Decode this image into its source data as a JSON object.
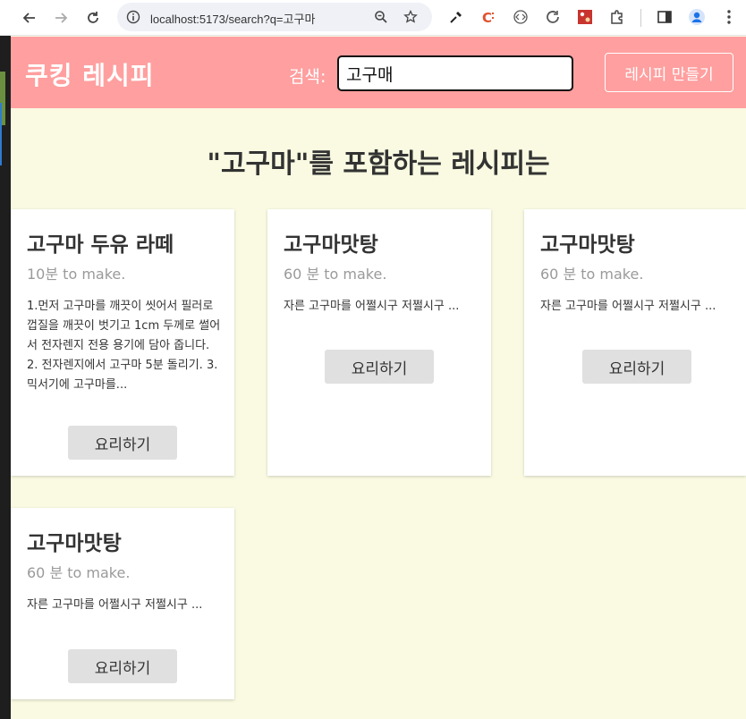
{
  "browser": {
    "url": "localhost:5173/search?q=고구마",
    "icons": [
      "back-arrow-icon",
      "forward-arrow-icon",
      "reload-icon",
      "site-info-icon",
      "zoom-icon",
      "bookmark-star-icon",
      "eyedropper-icon",
      "extension-c-icon",
      "extension-code-icon",
      "extension-refresh-icon",
      "extension-image-icon",
      "extensions-puzzle-icon",
      "side-panel-icon",
      "profile-icon",
      "menu-icon"
    ]
  },
  "header": {
    "logo": "쿠킹 레시피",
    "search_label": "검색:",
    "search_value": "고구매",
    "create_button": "레시피 만들기"
  },
  "results": {
    "heading": "\"고구마\"를 포함하는 레시피는"
  },
  "cards": [
    {
      "title": "고구마 두유 라떼",
      "time": "10분 to make.",
      "description": "1.먼저 고구마를 깨끗이 씻어서 필러로 껍질을 깨끗이 벗기고 1cm 두께로 썰어서 전자렌지 전용 용기에 담아 줍니다. 2. 전자렌지에서 고구마 5분 돌리기. 3. 믹서기에 고구마를...",
      "button": "요리하기"
    },
    {
      "title": "고구마맛탕",
      "time": "60 분 to make.",
      "description": "자른 고구마를 어쩔시구 저쩔시구 ...",
      "button": "요리하기"
    },
    {
      "title": "고구마맛탕",
      "time": "60 분 to make.",
      "description": "자른 고구마를 어쩔시구 저쩔시구 ...",
      "button": "요리하기"
    },
    {
      "title": "고구마맛탕",
      "time": "60 분 to make.",
      "description": "자른 고구마를 어쩔시구 저쩔시구 ...",
      "button": "요리하기"
    }
  ],
  "colors": {
    "header": "#ff9f9f",
    "background": "#f9fae1",
    "card": "#ffffff",
    "button": "#e0e0e0"
  }
}
